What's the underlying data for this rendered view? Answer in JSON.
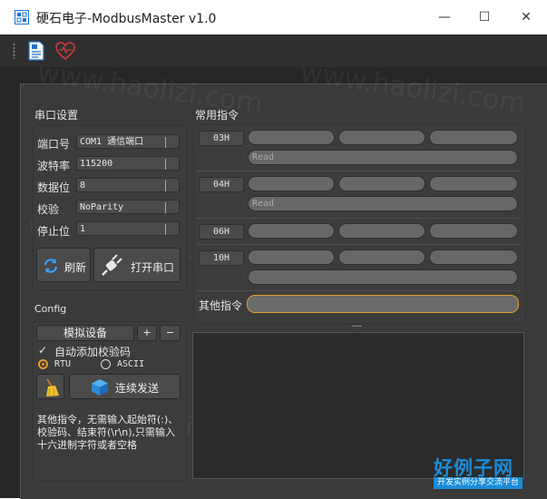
{
  "window": {
    "title": "硬石电子-ModbusMaster v1.0",
    "min_glyph": "—",
    "max_glyph": "☐",
    "close_glyph": "✕"
  },
  "toolbar": {
    "icons": [
      "document-icon",
      "heart-icon"
    ]
  },
  "serial": {
    "heading": "串口设置",
    "rows": [
      {
        "label": "端口号",
        "value": "COM1 通信端口"
      },
      {
        "label": "波特率",
        "value": "115200"
      },
      {
        "label": "数据位",
        "value": "8"
      },
      {
        "label": "校验",
        "value": "NoParity"
      },
      {
        "label": "停止位",
        "value": "1"
      }
    ],
    "refresh_label": "刷新",
    "open_label": "打开串口"
  },
  "config": {
    "heading": "Config",
    "device_label": "模拟设备",
    "plus": "+",
    "minus": "−",
    "auto_checksum_label": "自动添加校验码",
    "auto_checksum_checked": true,
    "mode_rtu": "RTU",
    "mode_ascii": "ASCII",
    "selected_mode": "RTU",
    "continuous_send_label": "连续发送",
    "note": "其他指令，无需输入起始符(:)、校验码、结束符(\\r\\n),只需输入十六进制字符或者空格"
  },
  "commands": {
    "heading": "常用指令",
    "items": [
      {
        "code": "03H",
        "read_placeholder": "Read"
      },
      {
        "code": "04H",
        "read_placeholder": "Read"
      },
      {
        "code": "06H"
      },
      {
        "code": "10H"
      }
    ],
    "other_label": "其他指令",
    "splitter": "......"
  },
  "watermark": {
    "text": "www.haolizi.com",
    "logo": "好例子网",
    "logo_sub": "开发实例分享交流平台"
  },
  "colors": {
    "accent_orange": "#e39a2d",
    "background": "#262626",
    "panel": "#3a3a3a"
  }
}
